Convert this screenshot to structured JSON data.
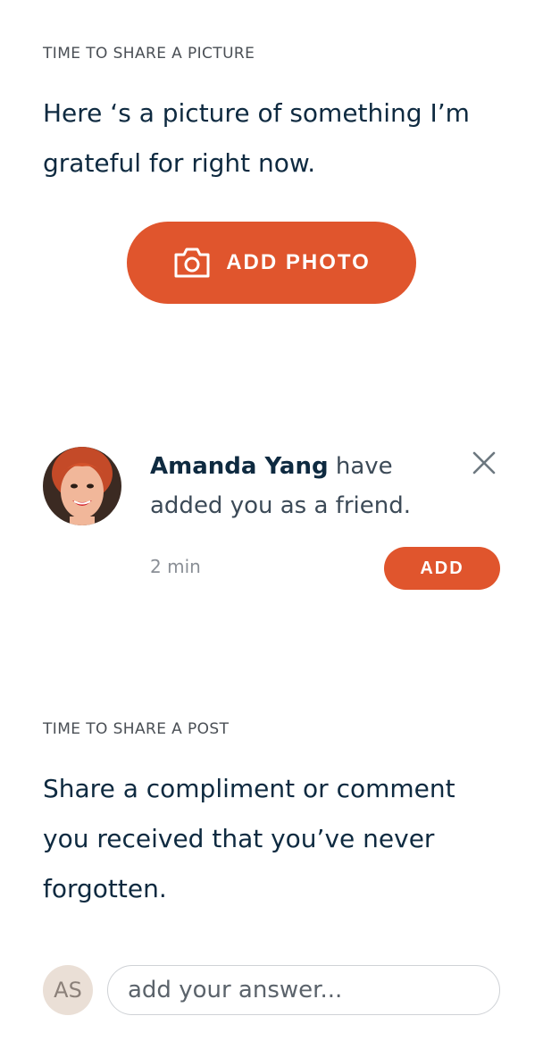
{
  "picture_section": {
    "eyebrow": "TIME TO SHARE A PICTURE",
    "prompt": "Here ‘s a picture of something I’m grateful for right now.",
    "button_label": "ADD PHOTO",
    "button_icon": "camera-icon"
  },
  "notification": {
    "avatar_alt": "avatar",
    "name": "Amanda Yang",
    "message": " have added you as a friend.",
    "time": "2 min",
    "add_label": "ADD",
    "close_icon": "close-icon"
  },
  "post_section": {
    "eyebrow": "TIME TO SHARE A POST",
    "prompt": "Share a compliment or comment you received that you’ve never forgotten.",
    "user_initials": "AS",
    "answer_placeholder": "add your answer..."
  },
  "colors": {
    "accent": "#e0552d",
    "text_dark": "#0e2a40",
    "initials_bg": "#eadfd6"
  }
}
